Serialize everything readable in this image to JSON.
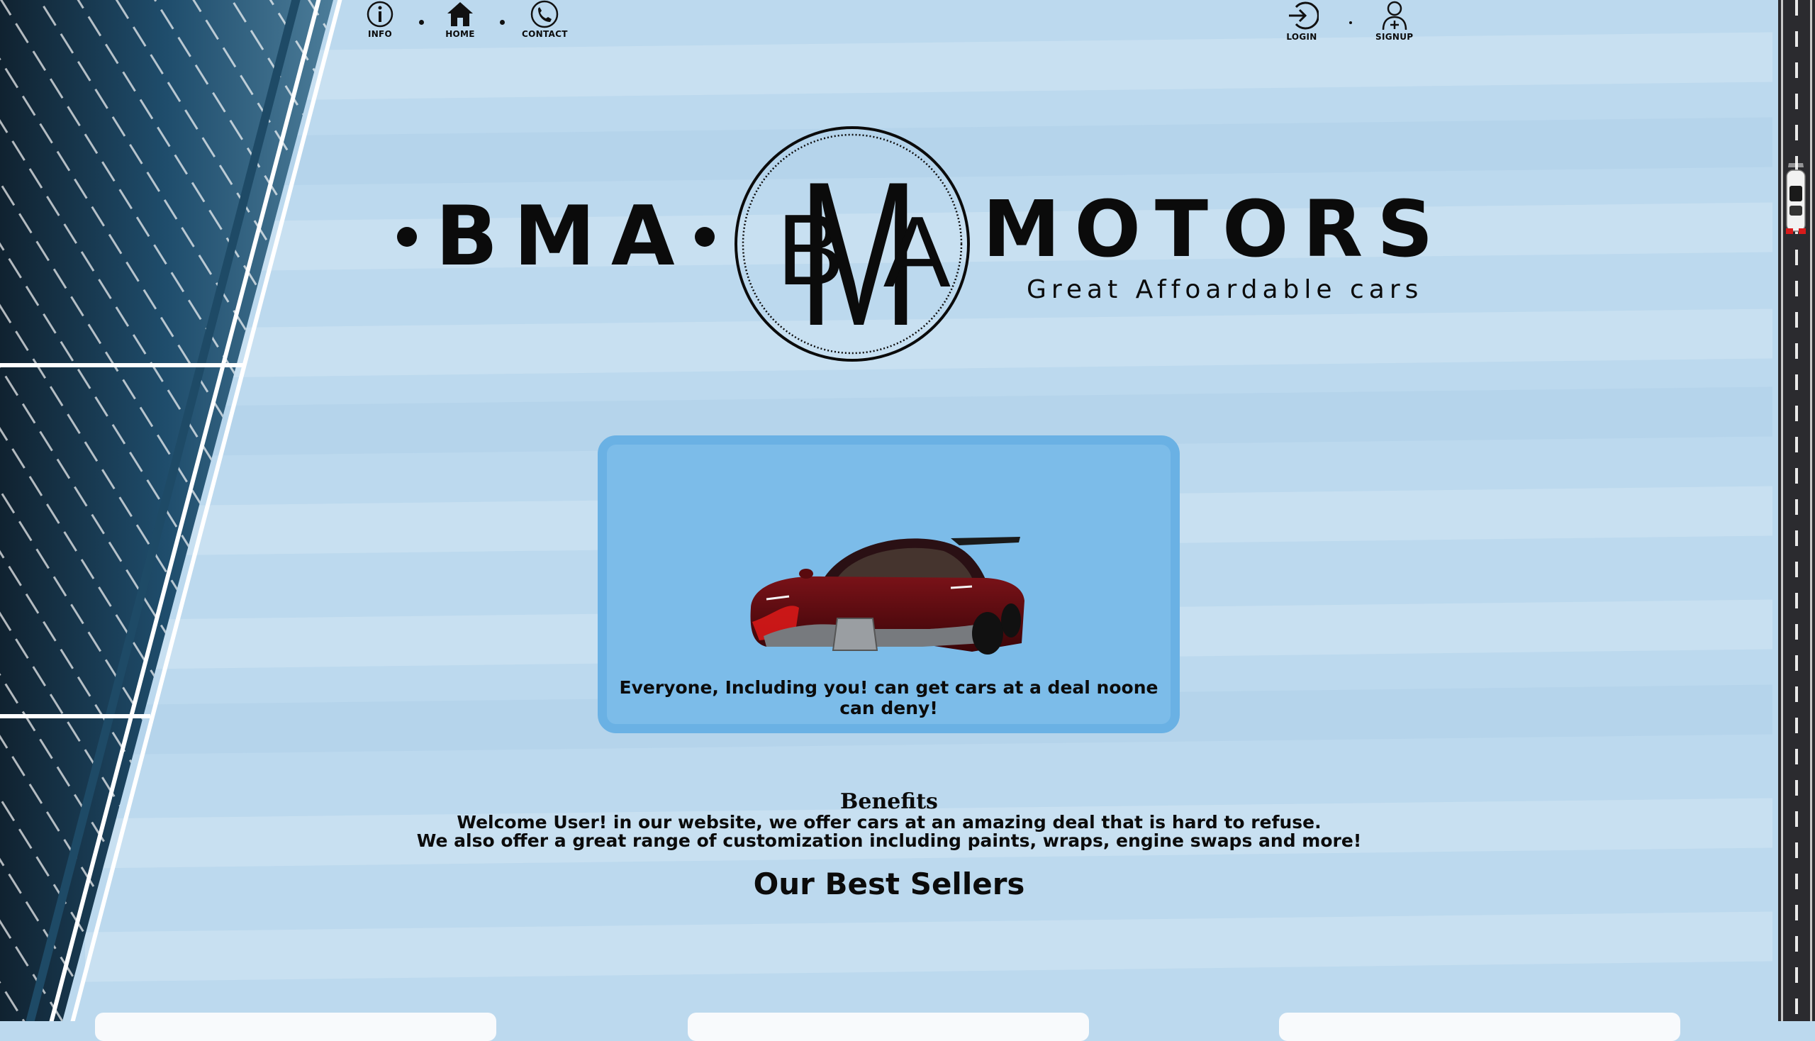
{
  "nav": {
    "info_label": "INFO",
    "home_label": "HOME",
    "contact_label": "CONTACT",
    "login_label": "LOGIN",
    "signup_label": "SIGNUP"
  },
  "brand": {
    "left_word": "BMA",
    "emblem_letters": [
      "B",
      "M",
      "A"
    ],
    "right_word": "MOTORS",
    "tagline": "Great Affoardable cars"
  },
  "hero": {
    "caption": "Everyone, Including you! can get cars at a deal noone can deny!"
  },
  "benefits": {
    "title": "Benefits",
    "line1": "Welcome User! in our website, we offer cars at an amazing deal that is hard to refuse.",
    "line2": "We also offer a great range of customization including paints, wraps, engine swaps and more!"
  },
  "best_sellers": {
    "title": "Our Best Sellers"
  },
  "colors": {
    "page_bg": "#bcd9ee",
    "card_bg": "#7cbce9",
    "card_border": "#6ab1e4",
    "text": "#0b0b0b",
    "car_body": "#5a0a0e"
  }
}
